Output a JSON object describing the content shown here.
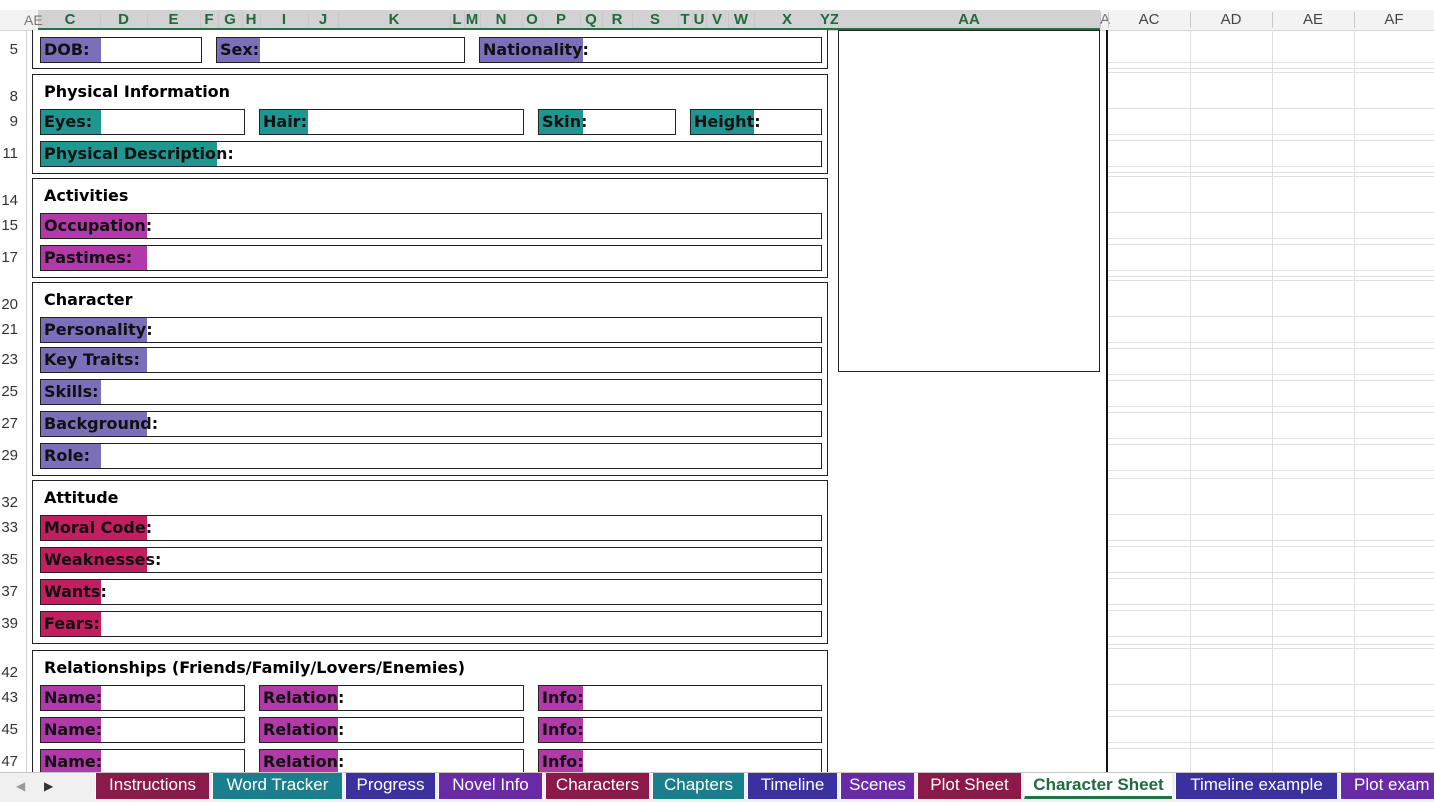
{
  "column_headers": {
    "left_partial": "AE",
    "letters": [
      "C",
      "D",
      "E",
      "F",
      "G",
      "H",
      "I",
      "J",
      "K",
      "L",
      "M",
      "N",
      "O",
      "P",
      "Q",
      "R",
      "S",
      "T",
      "U",
      "V",
      "W",
      "X",
      "Y",
      "Z",
      "AA",
      "A",
      "AC",
      "AD",
      "AE",
      "AF"
    ]
  },
  "row_numbers": [
    "5",
    "8",
    "9",
    "11",
    "14",
    "15",
    "17",
    "20",
    "21",
    "23",
    "25",
    "27",
    "29",
    "32",
    "33",
    "35",
    "37",
    "39",
    "42",
    "43",
    "45",
    "47"
  ],
  "sheet": {
    "identity": {
      "dob": "DOB:",
      "sex": "Sex:",
      "nationality": "Nationality:"
    },
    "physical": {
      "title": "Physical Information",
      "eyes": "Eyes:",
      "hair": "Hair:",
      "skin": "Skin:",
      "height": "Height:",
      "description": "Physical Description:"
    },
    "activities": {
      "title": "Activities",
      "occupation": "Occupation:",
      "pastimes": "Pastimes:"
    },
    "character": {
      "title": "Character",
      "personality": "Personality:",
      "key_traits": "Key Traits:",
      "skills": "Skills:",
      "background": "Background:",
      "role": "Role:"
    },
    "attitude": {
      "title": "Attitude",
      "moral_code": "Moral Code:",
      "weaknesses": "Weaknesses:",
      "wants": "Wants:",
      "fears": "Fears:"
    },
    "relationships": {
      "title": "Relationships (Friends/Family/Lovers/Enemies)",
      "name": "Name:",
      "relation": "Relation:",
      "info": "Info:"
    }
  },
  "tabs": [
    {
      "label": "Instructions",
      "color": "#8b1a4a"
    },
    {
      "label": "Word Tracker",
      "color": "#1a7f8c"
    },
    {
      "label": "Progress",
      "color": "#3a30a0"
    },
    {
      "label": "Novel Info",
      "color": "#6a2aa8"
    },
    {
      "label": "Characters",
      "color": "#8b1a4a"
    },
    {
      "label": "Chapters",
      "color": "#1a7f8c"
    },
    {
      "label": "Timeline",
      "color": "#3a30a0"
    },
    {
      "label": "Scenes",
      "color": "#6a2aa8"
    },
    {
      "label": "Plot Sheet",
      "color": "#8b1a4a"
    },
    {
      "label": "Character Sheet",
      "color": "#1a7f8c",
      "active": true
    },
    {
      "label": "Timeline example",
      "color": "#3a30a0"
    },
    {
      "label": "Plot exam",
      "color": "#6a2aa8"
    }
  ],
  "nav": {
    "prev": "◀",
    "next": "▶"
  }
}
